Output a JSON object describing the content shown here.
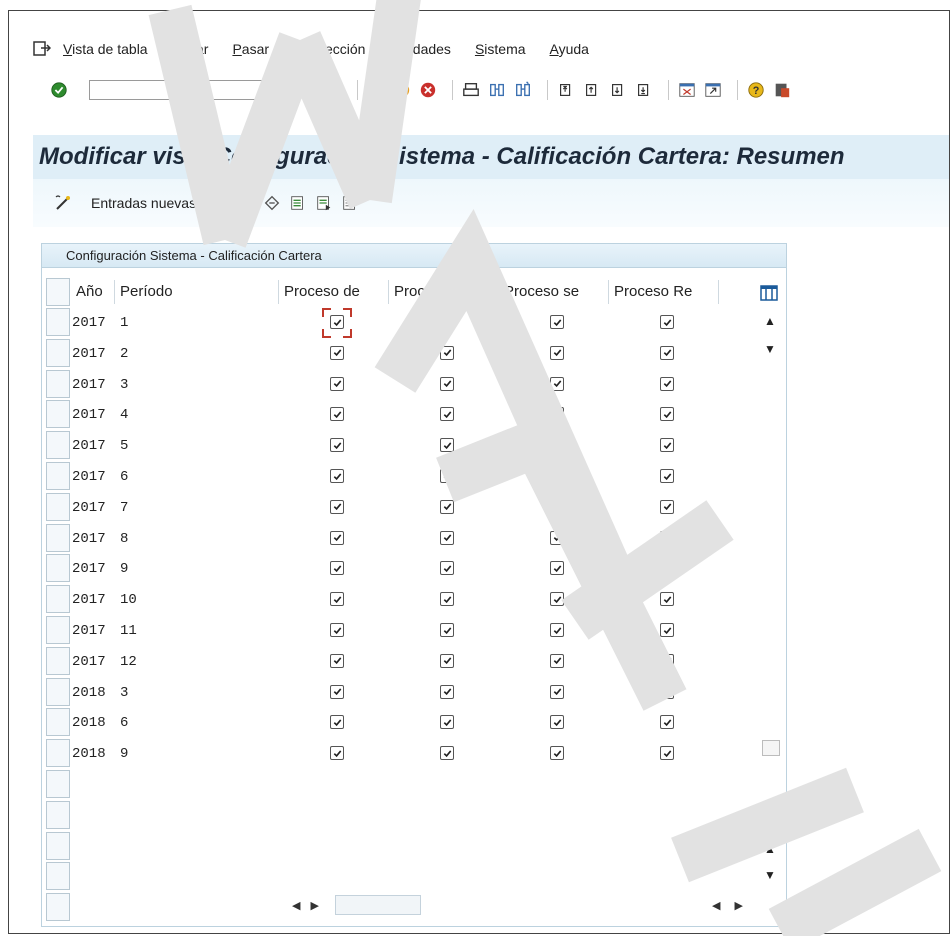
{
  "menu": [
    {
      "id": "vista",
      "underline": "V",
      "rest": "ista de tabla"
    },
    {
      "id": "tratar",
      "underline": "T",
      "rest": "ratar"
    },
    {
      "id": "pasar",
      "underline": "P",
      "rest": "asar a"
    },
    {
      "id": "seleccion",
      "pre": "S",
      "underline": "e",
      "rest": "lección"
    },
    {
      "id": "utilidades",
      "underline": "U",
      "rest": "tilidades"
    },
    {
      "id": "sistema",
      "underline": "S",
      "rest": "istema"
    },
    {
      "id": "ayuda",
      "underline": "A",
      "rest": "yuda"
    }
  ],
  "title": "Modificar vista Configuración Sistema - Calificación Cartera: Resumen",
  "app_toolbar": {
    "new_entries": "Entradas nuevas"
  },
  "table": {
    "caption": "Configuración Sistema - Calificación Cartera",
    "headers": {
      "ano": "Año",
      "periodo": "Período",
      "proc1": "Proceso de",
      "proc2": "Proceso pr",
      "proc3": "Proceso se",
      "proc4": "Proceso Re"
    },
    "rows": [
      {
        "ano": "2017",
        "periodo": "1",
        "checks": [
          true,
          true,
          true,
          true
        ]
      },
      {
        "ano": "2017",
        "periodo": "2",
        "checks": [
          true,
          true,
          true,
          true
        ]
      },
      {
        "ano": "2017",
        "periodo": "3",
        "checks": [
          true,
          true,
          true,
          true
        ]
      },
      {
        "ano": "2017",
        "periodo": "4",
        "checks": [
          true,
          true,
          true,
          true
        ]
      },
      {
        "ano": "2017",
        "periodo": "5",
        "checks": [
          true,
          true,
          true,
          true
        ]
      },
      {
        "ano": "2017",
        "periodo": "6",
        "checks": [
          true,
          true,
          true,
          true
        ]
      },
      {
        "ano": "2017",
        "periodo": "7",
        "checks": [
          true,
          true,
          true,
          true
        ]
      },
      {
        "ano": "2017",
        "periodo": "8",
        "checks": [
          true,
          true,
          true,
          true
        ]
      },
      {
        "ano": "2017",
        "periodo": "9",
        "checks": [
          true,
          true,
          true,
          true
        ]
      },
      {
        "ano": "2017",
        "periodo": "10",
        "checks": [
          true,
          true,
          true,
          true
        ]
      },
      {
        "ano": "2017",
        "periodo": "11",
        "checks": [
          true,
          true,
          true,
          true
        ]
      },
      {
        "ano": "2017",
        "periodo": "12",
        "checks": [
          true,
          true,
          true,
          true
        ]
      },
      {
        "ano": "2018",
        "periodo": "3",
        "checks": [
          true,
          true,
          true,
          true
        ]
      },
      {
        "ano": "2018",
        "periodo": "6",
        "checks": [
          true,
          true,
          true,
          true
        ]
      },
      {
        "ano": "2018",
        "periodo": "9",
        "checks": [
          true,
          true,
          true,
          true
        ]
      }
    ],
    "empty_rows": 5
  },
  "colors": {
    "title_band": "#dfeef7",
    "focus": "#c0392b",
    "watermark": "#e8e8e8"
  },
  "icons": [
    "menu-exit-icon",
    "enter-check-icon",
    "back-icon",
    "save-icon",
    "green-back-icon",
    "exit-icon",
    "cancel-icon",
    "print-icon",
    "find-icon",
    "find-next-icon",
    "first-page-icon",
    "prev-page-icon",
    "next-page-icon",
    "last-page-icon",
    "create-session-icon",
    "shortcut-icon",
    "help-icon",
    "customize-layout-icon",
    "new-entries-icon",
    "copy-icon",
    "delete-icon",
    "undo-icon",
    "select-all-icon",
    "select-block-icon",
    "deselect-all-icon",
    "column-config-icon"
  ]
}
